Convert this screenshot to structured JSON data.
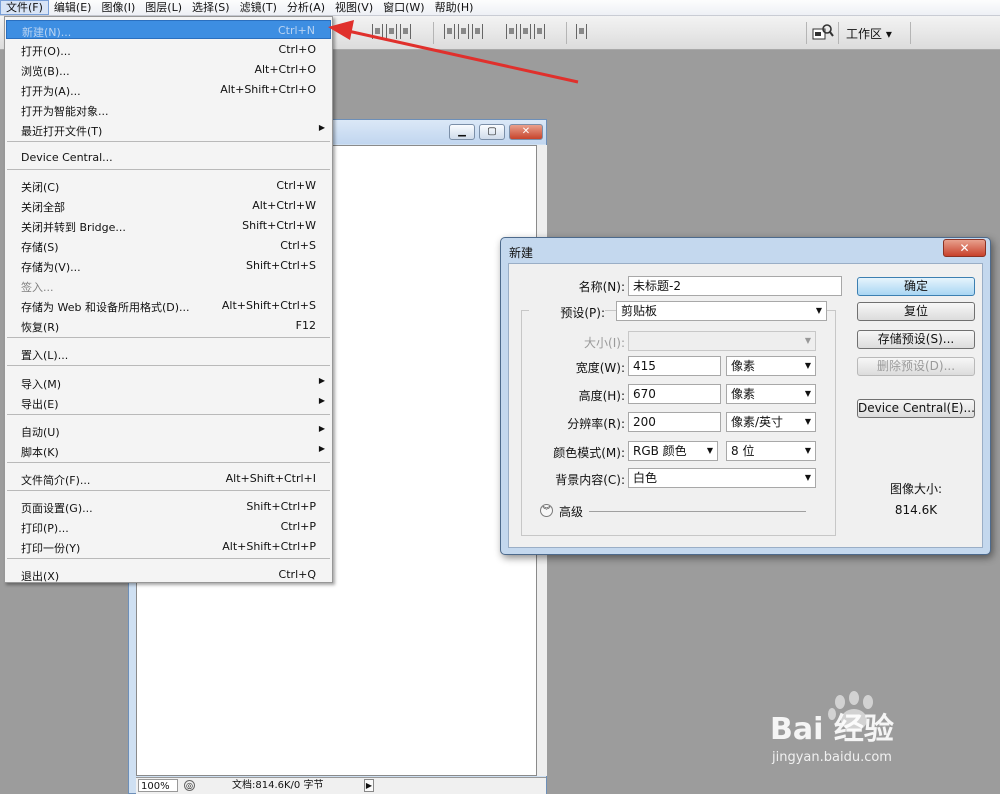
{
  "menubar": {
    "items": [
      "文件(F)",
      "编辑(E)",
      "图像(I)",
      "图层(L)",
      "选择(S)",
      "滤镜(T)",
      "分析(A)",
      "视图(V)",
      "窗口(W)",
      "帮助(H)"
    ]
  },
  "options_bar": {
    "workspace_label": "工作区 ▾"
  },
  "file_menu": {
    "items": [
      {
        "label": "新建(N)...",
        "shortcut": "Ctrl+N"
      },
      {
        "label": "打开(O)...",
        "shortcut": "Ctrl+O"
      },
      {
        "label": "浏览(B)...",
        "shortcut": "Alt+Ctrl+O"
      },
      {
        "label": "打开为(A)...",
        "shortcut": "Alt+Shift+Ctrl+O"
      },
      {
        "label": "打开为智能对象...",
        "shortcut": ""
      },
      {
        "label": "最近打开文件(T)",
        "shortcut": ""
      },
      {
        "label": "Device Central...",
        "shortcut": ""
      },
      {
        "label": "关闭(C)",
        "shortcut": "Ctrl+W"
      },
      {
        "label": "关闭全部",
        "shortcut": "Alt+Ctrl+W"
      },
      {
        "label": "关闭并转到 Bridge...",
        "shortcut": "Shift+Ctrl+W"
      },
      {
        "label": "存储(S)",
        "shortcut": "Ctrl+S"
      },
      {
        "label": "存储为(V)...",
        "shortcut": "Shift+Ctrl+S"
      },
      {
        "label": "签入...",
        "shortcut": ""
      },
      {
        "label": "存储为 Web 和设备所用格式(D)...",
        "shortcut": "Alt+Shift+Ctrl+S"
      },
      {
        "label": "恢复(R)",
        "shortcut": "F12"
      },
      {
        "label": "置入(L)...",
        "shortcut": ""
      },
      {
        "label": "导入(M)",
        "shortcut": ""
      },
      {
        "label": "导出(E)",
        "shortcut": ""
      },
      {
        "label": "自动(U)",
        "shortcut": ""
      },
      {
        "label": "脚本(K)",
        "shortcut": ""
      },
      {
        "label": "文件简介(F)...",
        "shortcut": "Alt+Shift+Ctrl+I"
      },
      {
        "label": "页面设置(G)...",
        "shortcut": "Shift+Ctrl+P"
      },
      {
        "label": "打印(P)...",
        "shortcut": "Ctrl+P"
      },
      {
        "label": "打印一份(Y)",
        "shortcut": "Alt+Shift+Ctrl+P"
      },
      {
        "label": "退出(X)",
        "shortcut": "Ctrl+Q"
      }
    ]
  },
  "document": {
    "zoom": "100%",
    "info": "文档:814.6K/0 字节"
  },
  "new_dialog": {
    "title": "新建",
    "close": "✕",
    "name_label": "名称(N):",
    "name_value": "未标题-2",
    "preset_label": "预设(P):",
    "preset_value": "剪贴板",
    "size_label": "大小(I):",
    "size_value": "",
    "width_label": "宽度(W):",
    "width_value": "415",
    "width_unit": "像素",
    "height_label": "高度(H):",
    "height_value": "670",
    "height_unit": "像素",
    "resolution_label": "分辨率(R):",
    "resolution_value": "200",
    "resolution_unit": "像素/英寸",
    "color_mode_label": "颜色模式(M):",
    "color_mode_value": "RGB 颜色",
    "bit_depth": "8 位",
    "background_label": "背景内容(C):",
    "background_value": "白色",
    "advanced_label": "高级",
    "buttons": {
      "ok": "确定",
      "reset": "复位",
      "save_preset": "存储预设(S)...",
      "delete_preset": "删除预设(D)...",
      "device_central": "Device Central(E)..."
    },
    "image_size_label": "图像大小:",
    "image_size_value": "814.6K"
  },
  "watermark": {
    "brand": "Bai 经验",
    "url": "jingyan.baidu.com"
  },
  "colors": {
    "menu_highlight": "#3d8ee2",
    "annotation_arrow": "#e0302c",
    "workspace_bg": "#9c9c9c"
  }
}
